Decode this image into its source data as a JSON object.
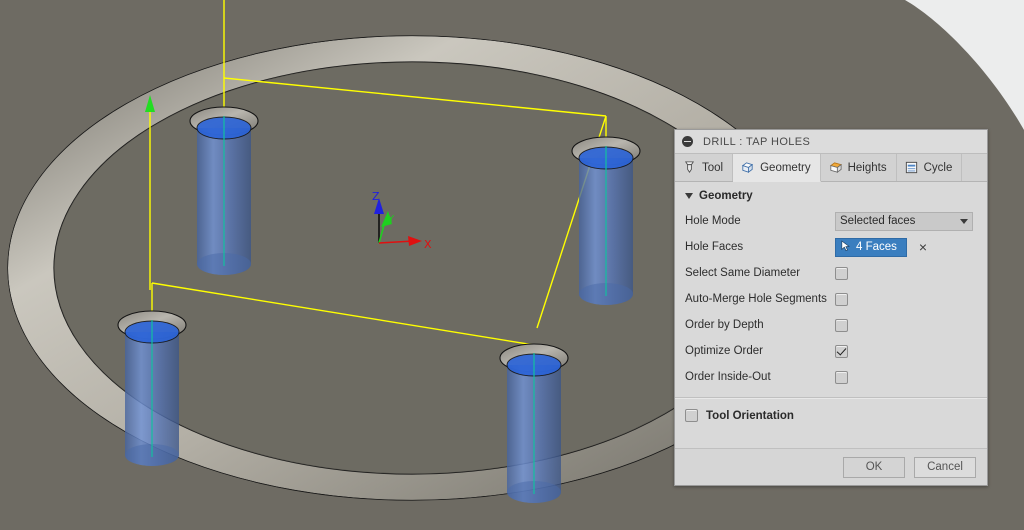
{
  "app": {
    "viewport_bg": "#6e6b63",
    "corner_bg": "#eceded"
  },
  "viewport": {
    "axis_triad": {
      "z_label": "Z",
      "y_label": "Y",
      "x_label": "X",
      "z_color": "#2020e0",
      "y_color": "#1fd01f",
      "x_color": "#e01010"
    },
    "toolpath": {
      "rapid_color": "#ffff00",
      "marker_color": "#22dd22",
      "hole_count": 4
    },
    "part": {
      "body_color": "#6e6b63",
      "rim_highlight": "#cfccc3",
      "edge_color": "#1a1a1a"
    },
    "holes": {
      "cylinder_color": "#5a7fc4",
      "centerline_color": "#12c0a0",
      "bore_color": "#2a63d8"
    }
  },
  "panel": {
    "title": "DRILL : TAP HOLES",
    "collapse_icon": "collapse-icon",
    "tabs": [
      {
        "label": "Tool",
        "icon": "drill-bit-icon",
        "active": false
      },
      {
        "label": "Geometry",
        "icon": "box-3d-icon",
        "active": true
      },
      {
        "label": "Heights",
        "icon": "heights-box-icon",
        "active": false
      },
      {
        "label": "Cycle",
        "icon": "cycle-icon",
        "active": false
      }
    ],
    "section": {
      "title": "Geometry"
    },
    "fields": {
      "hole_mode": {
        "label": "Hole Mode",
        "value": "Selected faces",
        "options": [
          "Selected faces"
        ]
      },
      "hole_faces": {
        "label": "Hole Faces",
        "value": "4 Faces",
        "cursor_icon": "cursor-arrow-icon",
        "clear_icon": "×",
        "accent": "#3a7ebf"
      }
    },
    "checkboxes": [
      {
        "label": "Select Same Diameter",
        "checked": false
      },
      {
        "label": "Auto-Merge Hole Segments",
        "checked": false
      },
      {
        "label": "Order by Depth",
        "checked": false
      },
      {
        "label": "Optimize Order",
        "checked": true
      },
      {
        "label": "Order Inside-Out",
        "checked": false
      }
    ],
    "tool_orientation": {
      "label": "Tool Orientation",
      "checked": false
    },
    "footer": {
      "ok": "OK",
      "cancel": "Cancel"
    }
  }
}
